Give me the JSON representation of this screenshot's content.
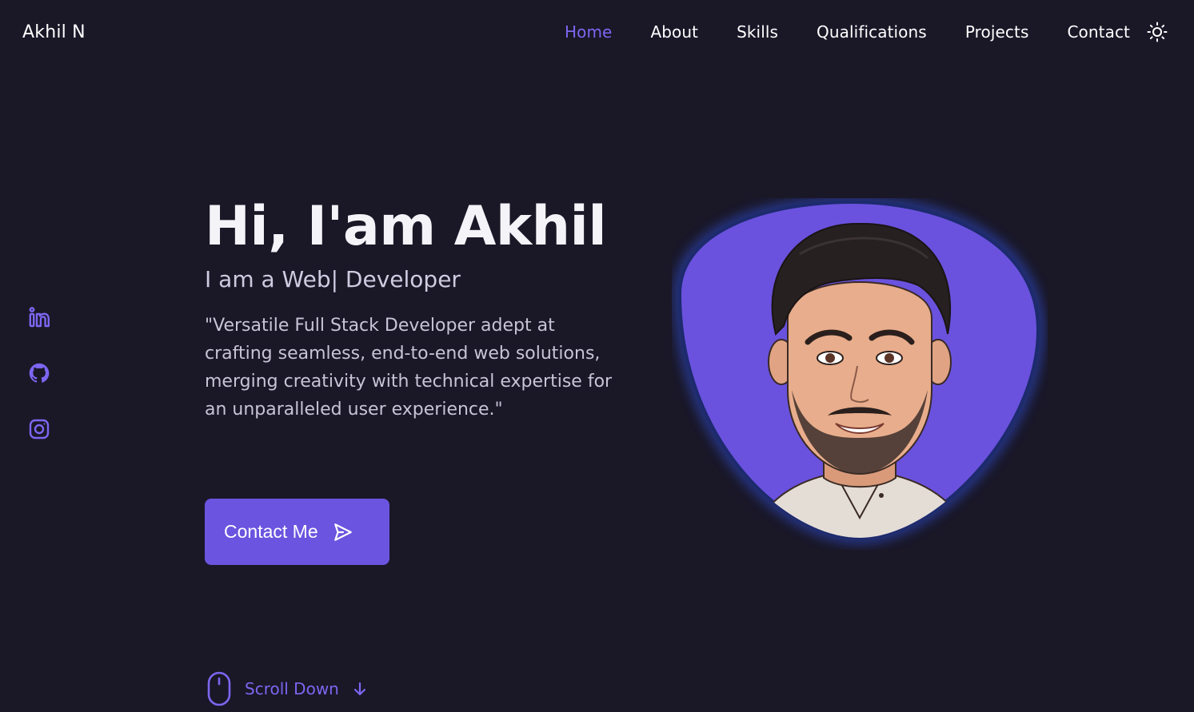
{
  "header": {
    "brand": "Akhil N",
    "nav": [
      {
        "label": "Home",
        "active": true
      },
      {
        "label": "About",
        "active": false
      },
      {
        "label": "Skills",
        "active": false
      },
      {
        "label": "Qualifications",
        "active": false
      },
      {
        "label": "Projects",
        "active": false
      },
      {
        "label": "Contact",
        "active": false
      }
    ],
    "theme_icon": "sun-icon"
  },
  "social": [
    {
      "icon": "linkedin-icon"
    },
    {
      "icon": "github-icon"
    },
    {
      "icon": "instagram-icon"
    }
  ],
  "hero": {
    "title": "Hi, I'am Akhil",
    "subtitle": "I am a Web| Developer",
    "description": "\"Versatile Full Stack Developer adept at crafting seamless, end-to-end web solutions, merging creativity with technical expertise for an unparalleled user experience.\"",
    "cta_label": "Contact Me",
    "cta_icon": "send-icon"
  },
  "scroll": {
    "label": "Scroll Down",
    "icons": [
      "mouse-icon",
      "arrow-down-icon"
    ]
  },
  "colors": {
    "background": "#1a1727",
    "accent": "#6b54df",
    "accent_text": "#7d66f0",
    "text": "#ffffff",
    "muted_text": "#c8c4d6"
  }
}
